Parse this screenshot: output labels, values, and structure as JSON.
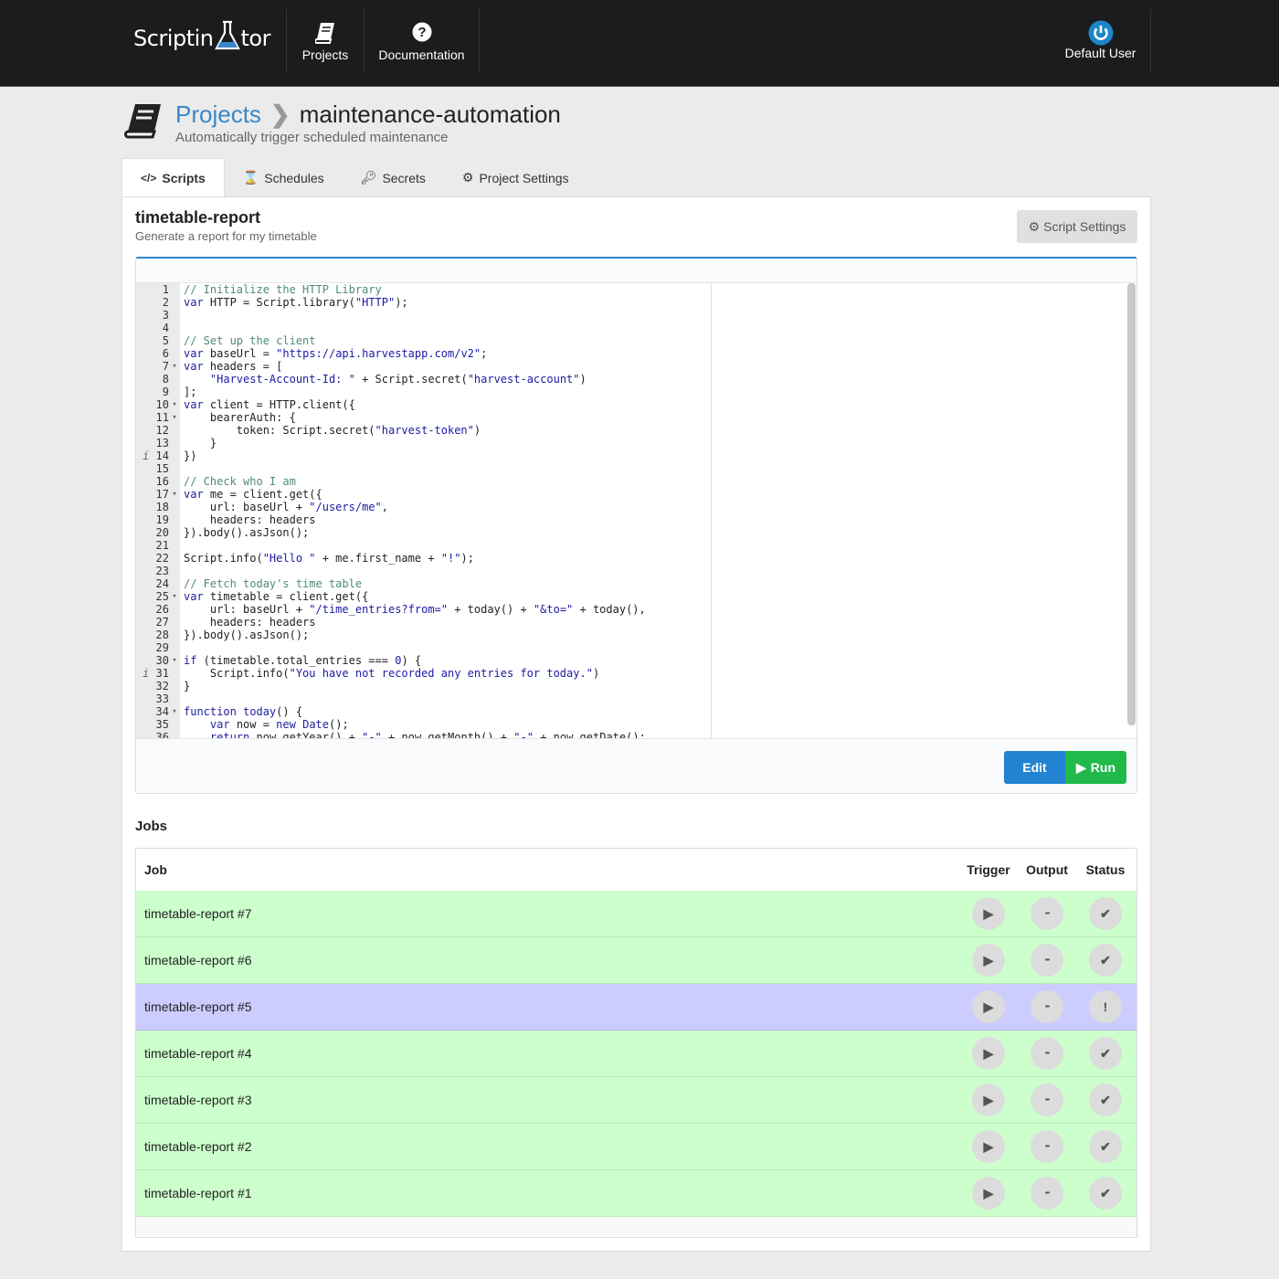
{
  "nav": {
    "brand_left": "Scriptin",
    "brand_right": "tor",
    "items": [
      {
        "label": "Projects",
        "icon": "book-icon"
      },
      {
        "label": "Documentation",
        "icon": "question-circle-icon"
      }
    ],
    "user": {
      "label": "Default User",
      "icon": "power-icon"
    }
  },
  "breadcrumb": {
    "root": "Projects",
    "current": "maintenance-automation",
    "description": "Automatically trigger scheduled maintenance"
  },
  "tabs": [
    {
      "label": "Scripts",
      "icon": "code-icon",
      "active": true
    },
    {
      "label": "Schedules",
      "icon": "hourglass-icon"
    },
    {
      "label": "Secrets",
      "icon": "key-icon"
    },
    {
      "label": "Project Settings",
      "icon": "gears-icon"
    }
  ],
  "script": {
    "title": "timetable-report",
    "description": "Generate a report for my timetable",
    "settings_label": "Script Settings"
  },
  "editor": {
    "lines": [
      [
        [
          "c",
          "// Initialize the HTTP Library"
        ]
      ],
      [
        [
          "k",
          "var"
        ],
        [
          "n",
          " HTTP = Script.library("
        ],
        [
          "s",
          "\"HTTP\""
        ],
        [
          "n",
          ");"
        ]
      ],
      [],
      [],
      [
        [
          "c",
          "// Set up the client"
        ]
      ],
      [
        [
          "k",
          "var"
        ],
        [
          "n",
          " baseUrl = "
        ],
        [
          "s",
          "\"https://api.harvestapp.com/v2\""
        ],
        [
          "n",
          ";"
        ]
      ],
      [
        [
          "k",
          "var"
        ],
        [
          "n",
          " headers = ["
        ]
      ],
      [
        [
          "n",
          "    "
        ],
        [
          "s",
          "\"Harvest-Account-Id: \""
        ],
        [
          "n",
          " + Script.secret("
        ],
        [
          "s",
          "\"harvest-account\""
        ],
        [
          "n",
          ")"
        ]
      ],
      [
        [
          "n",
          "];"
        ]
      ],
      [
        [
          "k",
          "var"
        ],
        [
          "n",
          " client = HTTP.client({"
        ]
      ],
      [
        [
          "n",
          "    bearerAuth: {"
        ]
      ],
      [
        [
          "n",
          "        token: Script.secret("
        ],
        [
          "s",
          "\"harvest-token\""
        ],
        [
          "n",
          ")"
        ]
      ],
      [
        [
          "n",
          "    }"
        ]
      ],
      [
        [
          "n",
          "})"
        ]
      ],
      [],
      [
        [
          "c",
          "// Check who I am"
        ]
      ],
      [
        [
          "k",
          "var"
        ],
        [
          "n",
          " me = client.get({"
        ]
      ],
      [
        [
          "n",
          "    url: baseUrl + "
        ],
        [
          "s",
          "\"/users/me\""
        ],
        [
          "n",
          ","
        ]
      ],
      [
        [
          "n",
          "    headers: headers"
        ]
      ],
      [
        [
          "n",
          "}).body().asJson();"
        ]
      ],
      [],
      [
        [
          "n",
          "Script.info("
        ],
        [
          "s",
          "\"Hello \""
        ],
        [
          "n",
          " + me.first_name + "
        ],
        [
          "s",
          "\"!\""
        ],
        [
          "n",
          ");"
        ]
      ],
      [],
      [
        [
          "c",
          "// Fetch today's time table"
        ]
      ],
      [
        [
          "k",
          "var"
        ],
        [
          "n",
          " timetable = client.get({"
        ]
      ],
      [
        [
          "n",
          "    url: baseUrl + "
        ],
        [
          "s",
          "\"/time_entries?from=\""
        ],
        [
          "n",
          " + today() + "
        ],
        [
          "s",
          "\"&to=\""
        ],
        [
          "n",
          " + today(),"
        ]
      ],
      [
        [
          "n",
          "    headers: headers"
        ]
      ],
      [
        [
          "n",
          "}).body().asJson();"
        ]
      ],
      [],
      [
        [
          "k",
          "if"
        ],
        [
          "n",
          " (timetable.total_entries === "
        ],
        [
          "s",
          "0"
        ],
        [
          "n",
          ") {"
        ]
      ],
      [
        [
          "n",
          "    Script.info("
        ],
        [
          "s",
          "\"You have not recorded any entries for today.\""
        ],
        [
          "n",
          ")"
        ]
      ],
      [
        [
          "n",
          "}"
        ]
      ],
      [],
      [
        [
          "k",
          "function"
        ],
        [
          "n",
          " "
        ],
        [
          "k",
          "today"
        ],
        [
          "n",
          "() {"
        ]
      ],
      [
        [
          "n",
          "    "
        ],
        [
          "k",
          "var"
        ],
        [
          "n",
          " now = "
        ],
        [
          "k",
          "new"
        ],
        [
          "n",
          " "
        ],
        [
          "k",
          "Date"
        ],
        [
          "n",
          "();"
        ]
      ],
      [
        [
          "n",
          "    "
        ],
        [
          "k",
          "return"
        ],
        [
          "n",
          " now.getYear() + "
        ],
        [
          "s",
          "\"-\""
        ],
        [
          "n",
          " + now.getMonth() + "
        ],
        [
          "s",
          "\"-\""
        ],
        [
          "n",
          " + now.getDate();"
        ]
      ]
    ],
    "fold_lines": [
      7,
      10,
      11,
      17,
      25,
      30,
      34
    ],
    "info_lines": [
      14,
      31
    ],
    "edit_label": "Edit",
    "run_label": "Run"
  },
  "jobs": {
    "heading": "Jobs",
    "columns": [
      "Job",
      "Trigger",
      "Output",
      "Status"
    ],
    "rows": [
      {
        "name": "timetable-report #7",
        "status": "success"
      },
      {
        "name": "timetable-report #6",
        "status": "success"
      },
      {
        "name": "timetable-report #5",
        "status": "error"
      },
      {
        "name": "timetable-report #4",
        "status": "success"
      },
      {
        "name": "timetable-report #3",
        "status": "success"
      },
      {
        "name": "timetable-report #2",
        "status": "success"
      },
      {
        "name": "timetable-report #1",
        "status": "success"
      }
    ]
  },
  "colors": {
    "accent": "#3a87c8",
    "edit": "#2283d2",
    "run": "#21b94a",
    "success_row": "#ccffcc",
    "error_row": "#ccccff",
    "topbar": "#1b1c1e"
  }
}
